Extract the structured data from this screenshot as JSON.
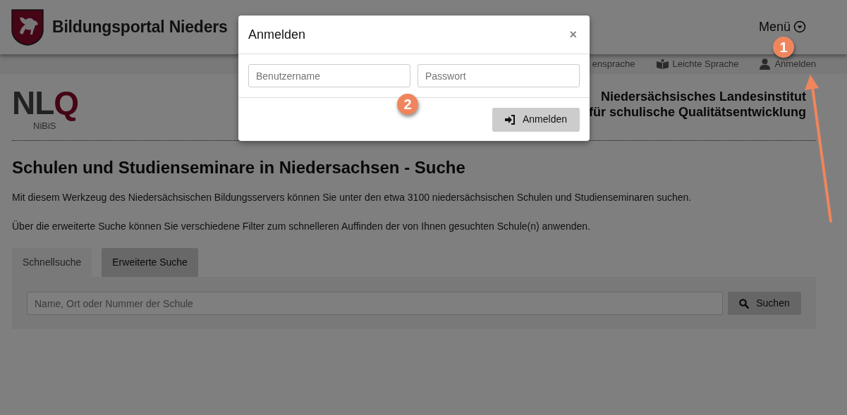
{
  "header": {
    "title": "Bildungsportal Nieders",
    "menu": "Menü"
  },
  "toolbar": [
    {
      "label": "ensprache",
      "kind": "text"
    },
    {
      "label": "Leichte Sprache",
      "kind": "book"
    },
    {
      "label": "Anmelden",
      "kind": "user"
    }
  ],
  "institute": {
    "logo_main": "NL",
    "logo_accent": "Q",
    "logo_sub": "NiBiS",
    "name_lines": [
      "Niedersächsisches Landesinstitut",
      "für schulische Qualitätsentwicklung"
    ]
  },
  "page": {
    "heading": "Schulen und Studienseminare in Niedersachsen - Suche",
    "paragraphs": [
      "Mit diesem Werkzeug des Niedersächsischen Bildungsservers können Sie unter den etwa 3100 niedersächsischen Schulen und Studienseminaren suchen.",
      "Über die erweiterte Suche können Sie verschiedene Filter zum schnelleren Auffinden der von Ihnen gesuchten Schule(n) anwenden."
    ]
  },
  "tabs": [
    {
      "label": "Schnellsuche",
      "selected": true
    },
    {
      "label": "Erweiterte Suche",
      "selected": false
    }
  ],
  "search": {
    "placeholder": "Name, Ort oder Nummer der Schule",
    "button": "Suchen"
  },
  "modal": {
    "title": "Anmelden",
    "close": "×",
    "fields": [
      {
        "placeholder": "Benutzername"
      },
      {
        "placeholder": "Passwort"
      }
    ],
    "submit": "Anmelden"
  },
  "callouts": [
    {
      "label": "1"
    },
    {
      "label": "2"
    }
  ]
}
